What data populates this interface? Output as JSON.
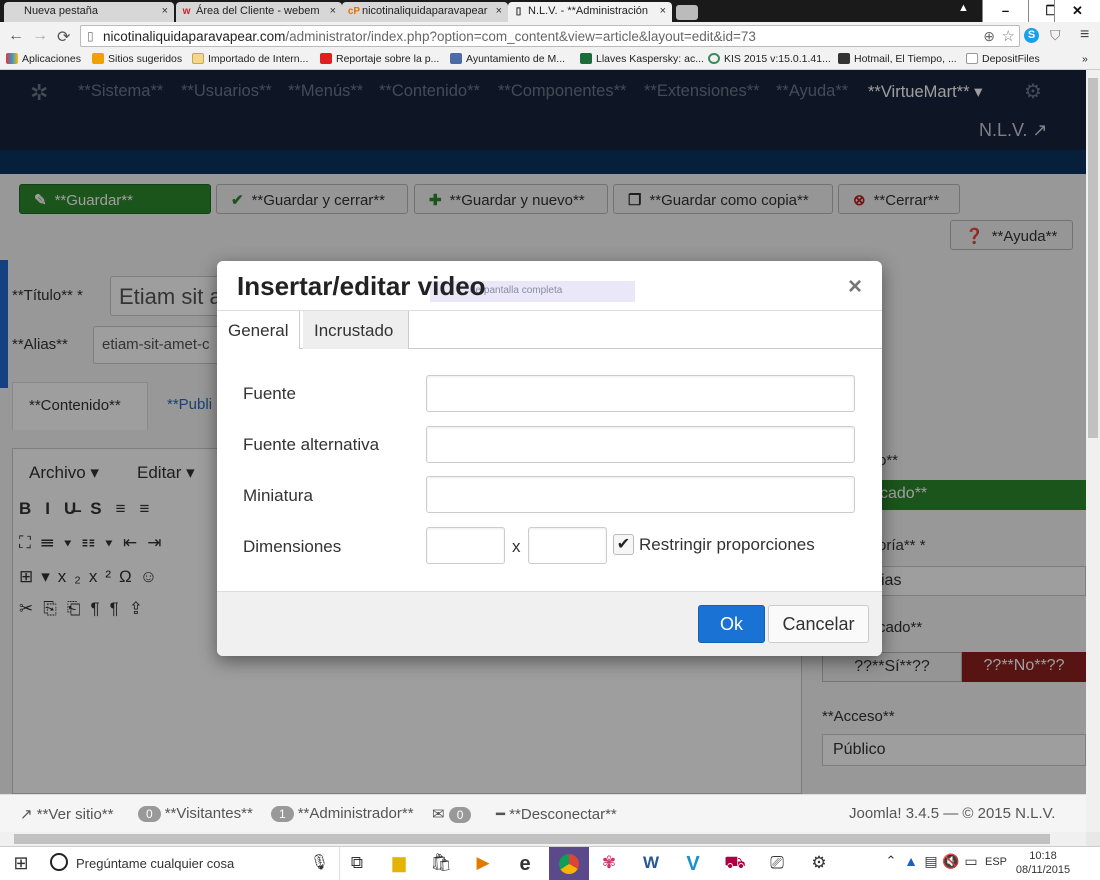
{
  "browser": {
    "tabs": [
      {
        "label": "Nueva pestaña",
        "favicon": ""
      },
      {
        "label": "Área del Cliente - webem",
        "favicon": "w"
      },
      {
        "label": "nicotinaliquidaparavapear",
        "favicon": "cP"
      },
      {
        "label": "N.L.V. - **Administración",
        "favicon": ""
      }
    ],
    "url_host": "nicotinaliquidaparavapear.com",
    "url_path": "/administrator/index.php?option=com_content&view=article&layout=edit&id=73",
    "bookmarks": [
      "Aplicaciones",
      "Sitios sugeridos",
      "Importado de Intern...",
      "Reportaje sobre la p...",
      "Ayuntamiento de M...",
      "Llaves Kaspersky: ac...",
      "KIS 2015 v:15.0.1.41...",
      "Hotmail, El Tiempo, ...",
      "DepositFiles"
    ]
  },
  "joomla": {
    "menu": [
      "**Sistema**",
      "**Usuarios**",
      "**Menús**",
      "**Contenido**",
      "**Componentes**",
      "**Extensiones**",
      "**Ayuda**",
      "**VirtueMart**"
    ],
    "site_name": "N.L.V.",
    "toolbar": {
      "save": "**Guardar**",
      "save_close": "**Guardar y cerrar**",
      "save_new": "**Guardar y nuevo**",
      "save_copy": "**Guardar como copia**",
      "close": "**Cerrar**",
      "help": "**Ayuda**"
    },
    "form": {
      "title_label": "**Título** *",
      "title_value": "Etiam sit a",
      "alias_label": "**Alias**",
      "alias_value": "etiam-sit-amet-c",
      "tab_content": "**Contenido**",
      "tab_publish": "**Publi"
    },
    "editor": {
      "menu_file": "Archivo",
      "menu_edit": "Editar"
    },
    "sidebar": {
      "status_label_frag": "o**",
      "status_value": "cado**",
      "category_label": "oría** *",
      "category_value": "ias",
      "featured_label": "cado**",
      "yes": "??**Sí**??",
      "no": "??**No**??",
      "access_label": "**Acceso**",
      "access_value": "Público"
    },
    "statusbar": {
      "view_site": "**Ver sitio**",
      "visitors_count": "0",
      "visitors": "**Visitantes**",
      "admin_count": "1",
      "admin": "**Administrador**",
      "msg_count": "0",
      "logout": "**Desconectar**",
      "version": "Joomla! 3.4.5 — © 2015 N.L.V."
    }
  },
  "modal": {
    "title": "Insertar/editar video",
    "ghost_text": "de pantalla completa",
    "tabs": [
      "General",
      "Incrustado"
    ],
    "fields": {
      "source_label": "Fuente",
      "alt_source_label": "Fuente alternativa",
      "thumb_label": "Miniatura",
      "dimensions_label": "Dimensiones",
      "dims_sep": "x",
      "constrain_label": "Restringir proporciones",
      "constrain_checked": true
    },
    "ok": "Ok",
    "cancel": "Cancelar"
  },
  "taskbar": {
    "search_placeholder": "Pregúntame cualquier cosa",
    "lang": "ESP",
    "time": "10:18",
    "date": "08/11/2015"
  },
  "colors": {
    "accent_blue": "#1a73d4",
    "save_green": "#2d8a2d",
    "nav_bg": "#17233a",
    "no_red": "#8f1f1f"
  }
}
